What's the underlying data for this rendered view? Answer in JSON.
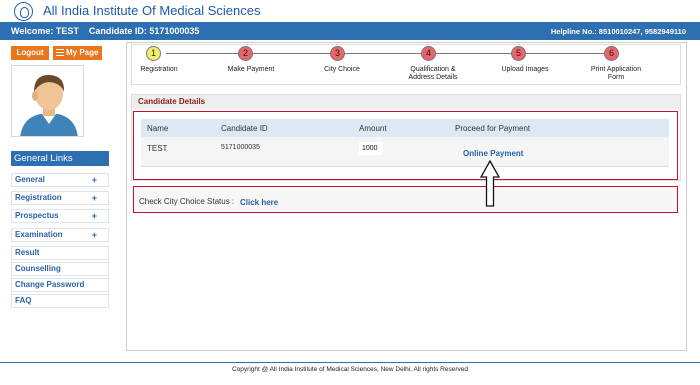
{
  "header": {
    "title": "All India Institute Of Medical Sciences",
    "logo_icon": "aiims-logo-icon"
  },
  "topbar": {
    "welcome": "Welcome: TEST    Candidate ID: 5171000035",
    "helpline": "Helpline No.: 8510010247, 9582949110"
  },
  "sidebar": {
    "logout_label": "Logout",
    "mypage_label": "My Page",
    "general_links_title": "General Links",
    "items": [
      {
        "label": "General",
        "has_plus": true
      },
      {
        "label": "Registration",
        "has_plus": true
      },
      {
        "label": "Prospectus",
        "has_plus": true
      },
      {
        "label": "Examination",
        "has_plus": true
      },
      {
        "label": "Result",
        "has_plus": false
      },
      {
        "label": "Counselling",
        "has_plus": false
      },
      {
        "label": "Change Password",
        "has_plus": false
      },
      {
        "label": "FAQ",
        "has_plus": false
      }
    ],
    "plus_symbol": "+"
  },
  "steps": [
    {
      "num": "1",
      "label": "Registration",
      "status": "done"
    },
    {
      "num": "2",
      "label": "Make Payment",
      "status": "todo"
    },
    {
      "num": "3",
      "label": "City Choice",
      "status": "todo"
    },
    {
      "num": "4",
      "label": "Qualification & Address Details",
      "status": "todo"
    },
    {
      "num": "5",
      "label": "Upload Images",
      "status": "todo"
    },
    {
      "num": "6",
      "label": "Print Application Form",
      "status": "todo"
    }
  ],
  "candidate": {
    "section_title": "Candidate Details",
    "columns": [
      "Name",
      "Candidate ID",
      "Amount",
      "Proceed for Payment"
    ],
    "row": {
      "name": "TEST",
      "id": "5171000035",
      "amount": "1000",
      "payment_link": "Online Payment"
    }
  },
  "city_status": {
    "label": "Check City Choice Status :",
    "link": "Click here"
  },
  "footer": {
    "text": "Copyright @ All India Institute of Medical Sciences, New Delhi. All rights Reserved"
  },
  "colors": {
    "primary_blue": "#2e6fb2",
    "orange": "#e8761c",
    "red_border": "#c8102e",
    "step_done": "#f2f06a",
    "step_todo": "#e9656b"
  }
}
